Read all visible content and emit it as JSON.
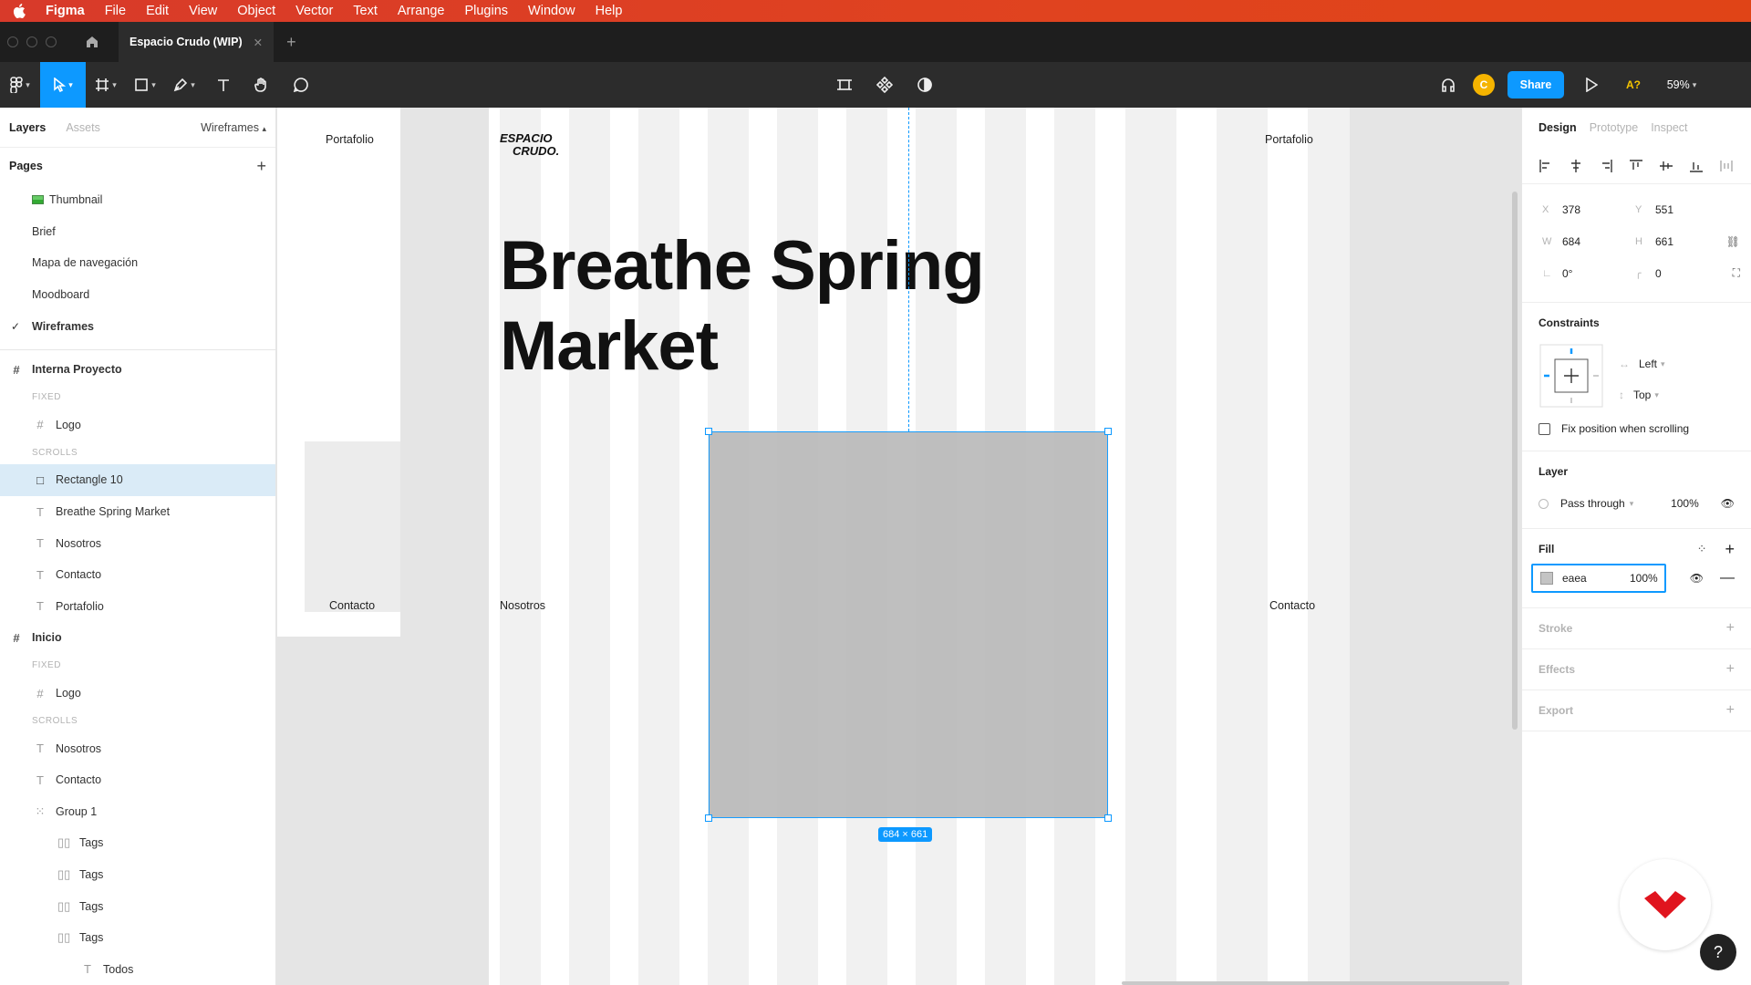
{
  "menubar": {
    "items": [
      "Figma",
      "File",
      "Edit",
      "View",
      "Object",
      "Vector",
      "Text",
      "Arrange",
      "Plugins",
      "Window",
      "Help"
    ]
  },
  "tabbar": {
    "file_tab": "Espacio Crudo (WIP)"
  },
  "toolbar": {
    "share": "Share",
    "avatar_initial": "C",
    "zoom": "59%",
    "aq": "A?"
  },
  "left_panel": {
    "tabs": [
      "Layers",
      "Assets"
    ],
    "current_page": "Wireframes",
    "pages_header": "Pages",
    "pages": [
      "Thumbnail",
      "Brief",
      "Mapa de navegación",
      "Moodboard",
      "Wireframes"
    ],
    "layers": {
      "frame1": "Interna Proyecto",
      "fixed_label": "FIXED",
      "scrolls_label": "SCROLLS",
      "f1_logo": "Logo",
      "f1_items": [
        "Rectangle 10",
        "Breathe Spring Market",
        "Nosotros",
        "Contacto",
        "Portafolio"
      ],
      "frame2": "Inicio",
      "f2_logo": "Logo",
      "f2_items": [
        "Nosotros",
        "Contacto"
      ],
      "group": "Group 1",
      "tags": [
        "Tags",
        "Tags",
        "Tags",
        "Tags"
      ],
      "todos": "Todos"
    }
  },
  "canvas": {
    "portafolio_left": "Portafolio",
    "contacto_left": "Contacto",
    "logo_line1": "ESPACIO",
    "logo_line2": "CRUDO.",
    "headline_line1": "Breathe Spring",
    "headline_line2": "Market",
    "nosotros": "Nosotros",
    "portafolio_right": "Portafolio",
    "contacto_right": "Contacto",
    "dimensions": "684 × 661"
  },
  "right_panel": {
    "tabs": [
      "Design",
      "Prototype",
      "Inspect"
    ],
    "x_label": "X",
    "x": "378",
    "y_label": "Y",
    "y": "551",
    "w_label": "W",
    "w": "684",
    "h_label": "H",
    "h": "661",
    "rotation": "0°",
    "radius": "0",
    "constraints_title": "Constraints",
    "constraint_h": "Left",
    "constraint_v": "Top",
    "fix_position": "Fix position when scrolling",
    "layer_title": "Layer",
    "blend": "Pass through",
    "layer_opacity": "100%",
    "fill_title": "Fill",
    "fill_value": "eaea",
    "fill_opacity": "100%",
    "stroke_title": "Stroke",
    "effects_title": "Effects",
    "export_title": "Export"
  },
  "help": "?",
  "colors": {
    "accent": "#0d99ff",
    "menubar": "#e0431f",
    "selected_row": "#daebf7"
  }
}
